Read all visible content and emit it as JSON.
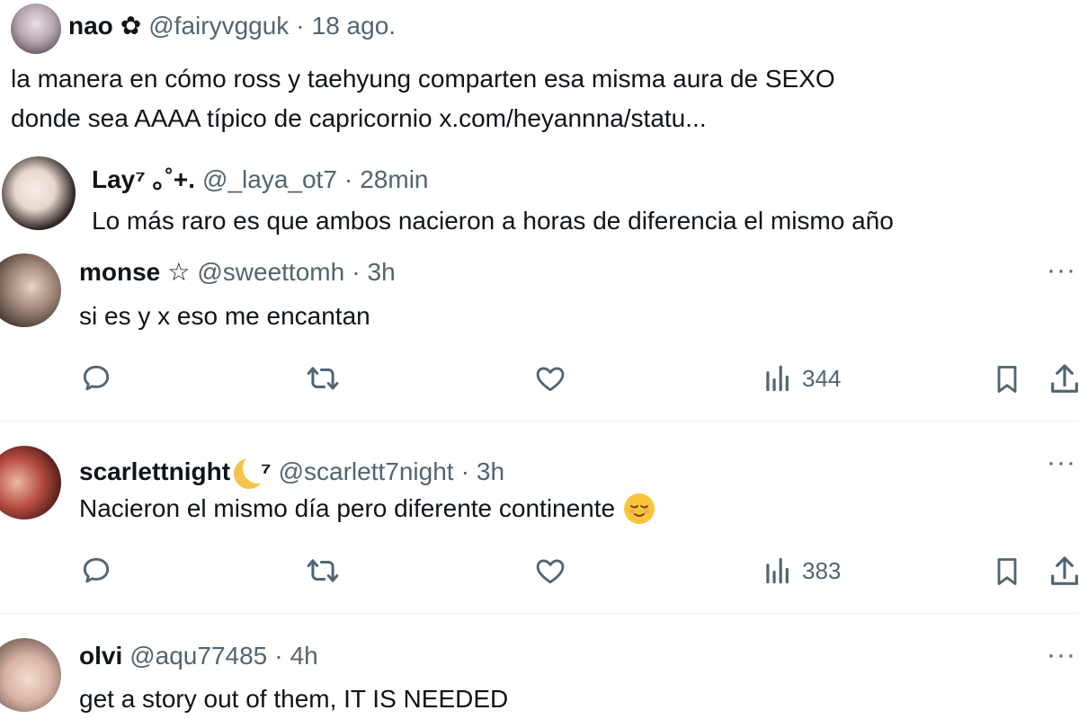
{
  "quoted": {
    "name": "nao",
    "badge": "✿",
    "handle": "@fairyvgguk",
    "time": "18 ago.",
    "text_line1": "la manera en cómo ross y taehyung comparten esa misma aura de SEXO",
    "text_line2": "donde sea AAAA típico de capricornio x.com/heyannna/statu..."
  },
  "quote_reply": {
    "name": "Lay",
    "name_suffix": "⁷ ｡˚+.",
    "handle": "@_laya_ot7",
    "time": "28min",
    "text": "Lo más raro es que ambos nacieron  a horas de diferencia el mismo año"
  },
  "replies": [
    {
      "name": "monse",
      "name_suffix": "☆",
      "handle": "@sweettomh",
      "time": "3h",
      "text": "si es y x eso me encantan",
      "views": "344",
      "more": "···"
    },
    {
      "name": "scarlettnight",
      "name_suffix": "⁷",
      "handle": "@scarlett7night",
      "time": "3h",
      "text": "Nacieron el mismo día pero diferente continente",
      "views": "383",
      "more": "···"
    },
    {
      "name": "olvi",
      "name_suffix": "",
      "handle": "@aqu77485",
      "time": "4h",
      "text": "get a story out of them, IT IS NEEDED",
      "more": "···"
    }
  ],
  "colors": {
    "text": "#0f1419",
    "secondary": "#536471",
    "divider": "#eff3f4"
  },
  "icons": [
    "reply-icon",
    "retweet-icon",
    "like-icon",
    "views-icon",
    "bookmark-icon",
    "share-icon",
    "more-icon",
    "moon-emoji",
    "relieved-emoji"
  ]
}
